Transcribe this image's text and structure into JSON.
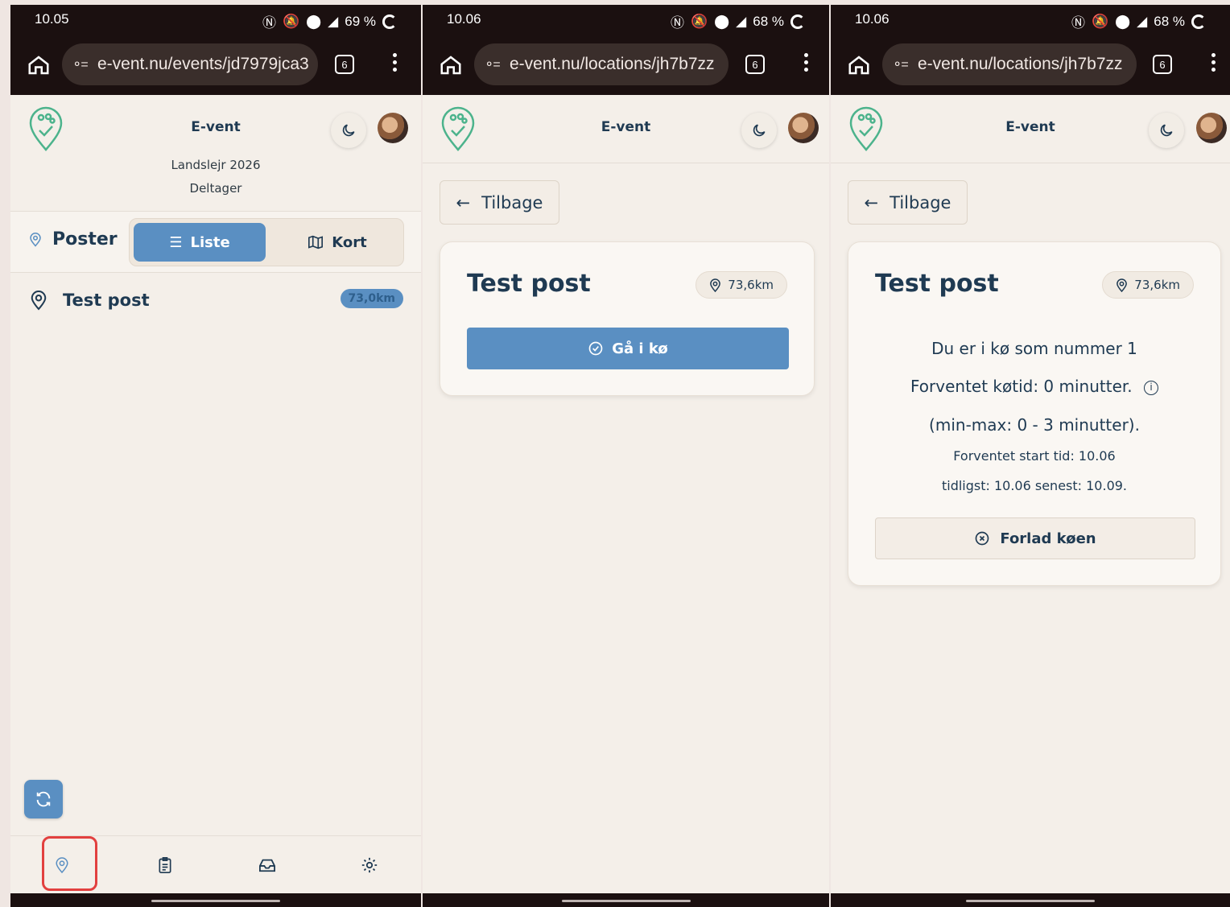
{
  "colors": {
    "accent": "#5a8fc2",
    "logo_green": "#4cb38c",
    "statusbar": "#1b1010",
    "highlight": "#e2403f"
  },
  "phone1": {
    "status": {
      "time": "10.05",
      "battery": "69 %"
    },
    "url": "e-vent.nu/events/jd7979jca3",
    "tabs_count": "6",
    "header": {
      "title": "E-vent",
      "event": "Landslejr 2026",
      "role": "Deltager"
    },
    "poster_label": "Poster",
    "segment": {
      "list": "Liste",
      "map": "Kort"
    },
    "items": [
      {
        "name": "Test post",
        "distance": "73,0km"
      }
    ],
    "nav_icons": [
      "location-icon",
      "clipboard-icon",
      "inbox-icon",
      "gear-icon"
    ]
  },
  "phone2": {
    "status": {
      "time": "10.06",
      "battery": "68 %"
    },
    "url": "e-vent.nu/locations/jh7b7zz",
    "tabs_count": "6",
    "header": {
      "title": "E-vent"
    },
    "back": "Tilbage",
    "card": {
      "title": "Test post",
      "distance": "73,6km",
      "join": "Gå i kø"
    }
  },
  "phone3": {
    "status": {
      "time": "10.06",
      "battery": "68 %"
    },
    "url": "e-vent.nu/locations/jh7b7zz",
    "tabs_count": "6",
    "header": {
      "title": "E-vent"
    },
    "back": "Tilbage",
    "card": {
      "title": "Test post",
      "distance": "73,6km",
      "queue_position": "Du er i kø som nummer 1",
      "expected_wait": "Forventet køtid: 0 minutter.",
      "range": "(min-max: 0 - 3 minutter).",
      "start_time": "Forventet start tid: 10.06",
      "earliest_latest": "tidligst: 10.06 senest: 10.09.",
      "leave": "Forlad køen"
    }
  }
}
